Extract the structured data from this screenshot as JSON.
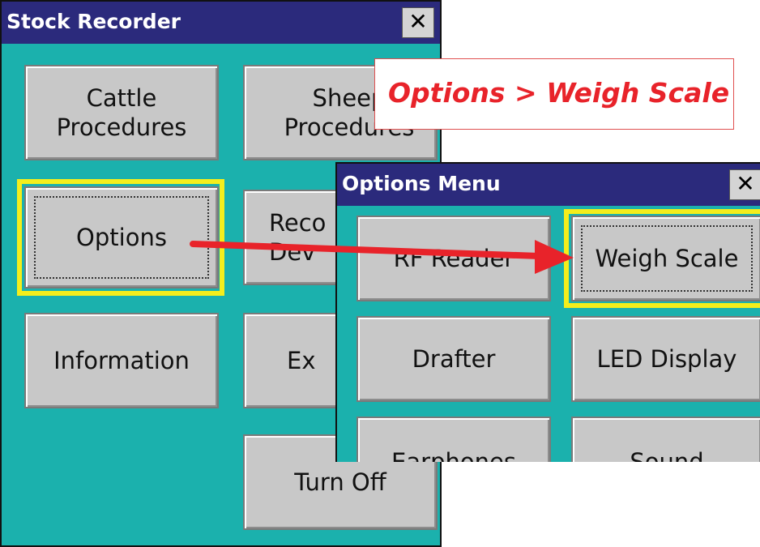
{
  "main_window": {
    "title": "Stock Recorder",
    "close_glyph": "✕",
    "buttons": {
      "cattle": "Cattle\nProcedures",
      "sheep": "Sheep\nProcedures",
      "options": "Options",
      "records": "Reco\nDev",
      "information": "Information",
      "exit": "Ex",
      "turn_off": "Turn Off"
    }
  },
  "callout": {
    "text": "Options > Weigh Scale"
  },
  "options_window": {
    "title": "Options Menu",
    "close_glyph": "✕",
    "buttons": {
      "rf_reader": "RF Reader",
      "weigh_scale": "Weigh Scale",
      "drafter": "Drafter",
      "led_display": "LED Display",
      "earphones": "Earphones",
      "sound": "Sound"
    }
  },
  "colors": {
    "background": "#1bb1ad",
    "titlebar": "#2b2a7c",
    "highlight": "#f4ee1c",
    "arrow": "#e8232a"
  },
  "icons": [
    "close-icon",
    "arrow-annotation"
  ]
}
